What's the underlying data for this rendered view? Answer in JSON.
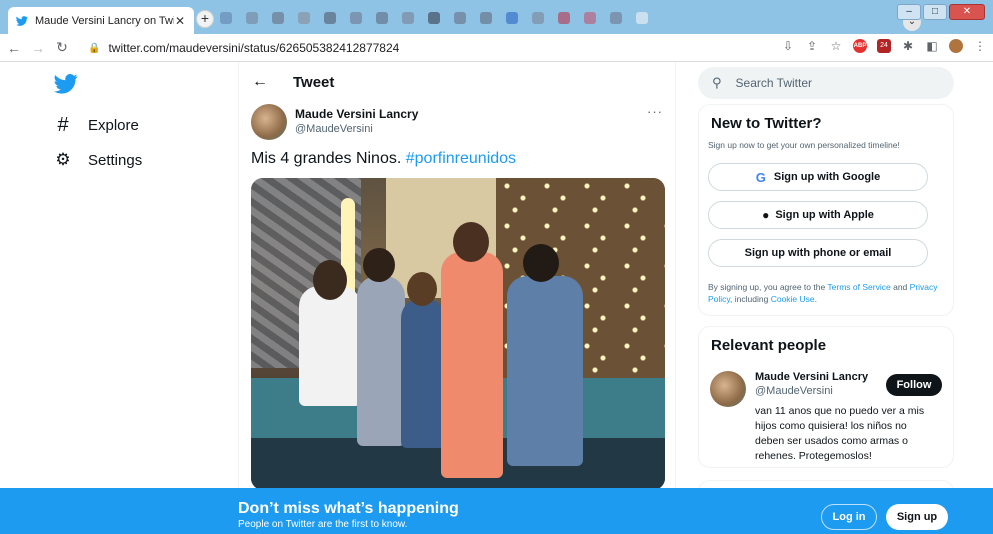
{
  "browser": {
    "tab_title": "Maude Versini Lancry on Twitter:",
    "tab_close": "✕",
    "new_tab": "+",
    "url": "twitter.com/maudeversini/status/626505382412877824",
    "tab_menu": "⌄"
  },
  "sidebar": {
    "items": [
      {
        "icon": "hashtag-icon",
        "label": "Explore"
      },
      {
        "icon": "gear-icon",
        "label": "Settings"
      }
    ]
  },
  "main": {
    "header_title": "Tweet",
    "author_name": "Maude Versini Lancry",
    "author_handle": "@MaudeVersini",
    "tweet_text": "Mis 4 grandes Ninos.",
    "tweet_hashtag": "#porfinreunidos"
  },
  "right": {
    "search_placeholder": "Search Twitter",
    "new_to_twitter": {
      "title": "New to Twitter?",
      "subtitle": "Sign up now to get your own personalized timeline!",
      "google_label": "Sign up with Google",
      "apple_label": "Sign up with Apple",
      "phone_label": "Sign up with phone or email",
      "legal_prefix": "By signing up, you agree to the",
      "terms_link": "Terms of Service",
      "legal_and": "and",
      "privacy_link": "Privacy Policy",
      "legal_including": ", including",
      "cookie_link": "Cookie Use",
      "legal_end": "."
    },
    "relevant_people": {
      "title": "Relevant people",
      "name": "Maude Versini Lancry",
      "handle": "@MaudeVersini",
      "follow_label": "Follow",
      "bio": "van 11 anos que no puedo ver a mis hijos como quisiera! los niños no deben ser usados como armas o rehenes. Protegemoslos!"
    }
  },
  "banner": {
    "headline": "Don’t miss what’s happening",
    "subline": "People on Twitter are the first to know.",
    "login_label": "Log in",
    "signup_label": "Sign up"
  },
  "colors": {
    "accent": "#1d9bf0",
    "text": "#0f1419",
    "muted": "#536471"
  }
}
